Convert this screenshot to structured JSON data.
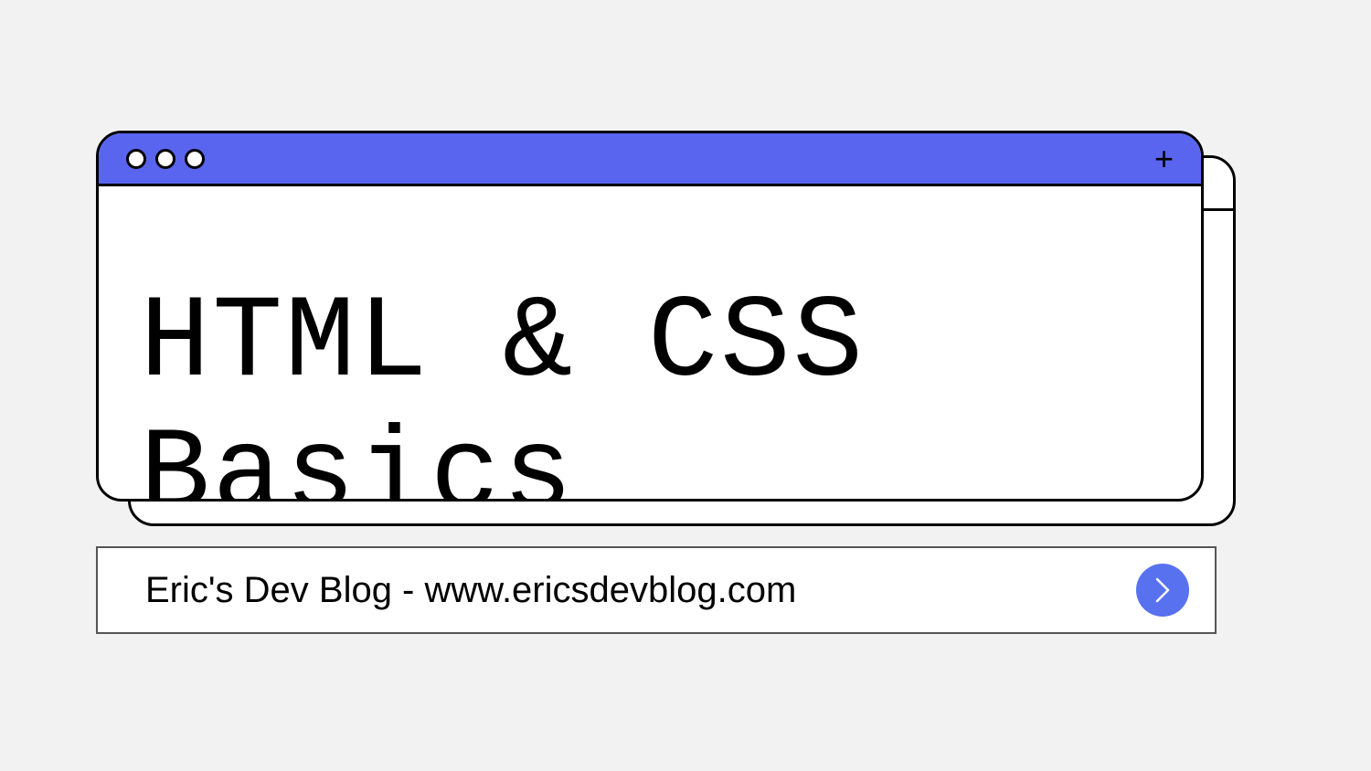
{
  "window": {
    "title": "HTML & CSS Basics"
  },
  "urlbar": {
    "text": "Eric's Dev Blog - www.ericsdevblog.com"
  },
  "icons": {
    "plus": "+",
    "go": "chevron-right"
  },
  "colors": {
    "accent": "#5965ef",
    "button": "#5871ef",
    "background": "#f2f2f2"
  }
}
